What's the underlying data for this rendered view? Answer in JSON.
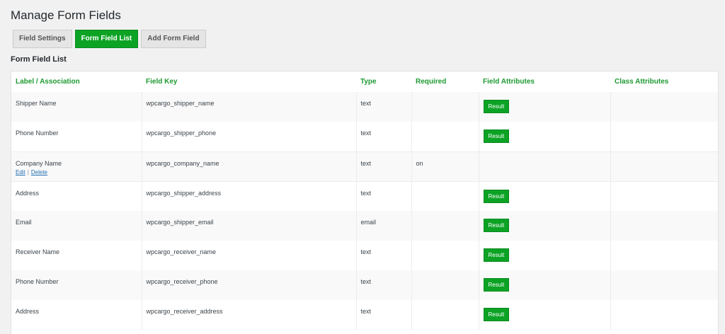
{
  "page": {
    "title": "Manage Form Fields",
    "section_title": "Form Field List"
  },
  "tabs": [
    {
      "label": "Field Settings",
      "active": false
    },
    {
      "label": "Form Field List",
      "active": true
    },
    {
      "label": "Add Form Field",
      "active": false
    }
  ],
  "table": {
    "columns": [
      "Label / Association",
      "Field Key",
      "Type",
      "Required",
      "Field Attributes",
      "Class Attributes"
    ],
    "rows": [
      {
        "label": "Shipper Name",
        "key": "wpcargo_shipper_name",
        "type": "text",
        "required": "",
        "attr_button": "Result",
        "actions": false
      },
      {
        "label": "Phone Number",
        "key": "wpcargo_shipper_phone",
        "type": "text",
        "required": "",
        "attr_button": "Result",
        "actions": false
      },
      {
        "label": "Company Name",
        "key": "wpcargo_company_name",
        "type": "text",
        "required": "on",
        "attr_button": "",
        "actions": true
      },
      {
        "label": "Address",
        "key": "wpcargo_shipper_address",
        "type": "text",
        "required": "",
        "attr_button": "Result",
        "actions": false
      },
      {
        "label": "Email",
        "key": "wpcargo_shipper_email",
        "type": "email",
        "required": "",
        "attr_button": "Result",
        "actions": false
      },
      {
        "label": "Receiver Name",
        "key": "wpcargo_receiver_name",
        "type": "text",
        "required": "",
        "attr_button": "Result",
        "actions": false
      },
      {
        "label": "Phone Number",
        "key": "wpcargo_receiver_phone",
        "type": "text",
        "required": "",
        "attr_button": "Result",
        "actions": false
      },
      {
        "label": "Address",
        "key": "wpcargo_receiver_address",
        "type": "text",
        "required": "",
        "attr_button": "Result",
        "actions": false
      }
    ],
    "row_actions": {
      "edit": "Edit",
      "separator": "|",
      "delete": "Delete"
    }
  },
  "colors": {
    "accent": "#0ca325",
    "header_text": "#1e9a32",
    "link": "#2271b1"
  }
}
